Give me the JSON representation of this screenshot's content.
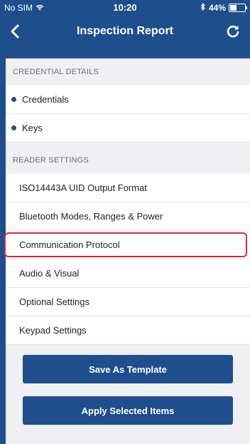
{
  "status_bar": {
    "carrier": "No SIM",
    "time": "10:20",
    "battery": "44%",
    "battery_level": 0.44
  },
  "nav": {
    "title": "Inspection Report",
    "back_icon": "chevron-left-icon",
    "refresh_icon": "refresh-icon"
  },
  "sections": {
    "credential_details": {
      "header": "CREDENTIAL DETAILS",
      "items": [
        "Credentials",
        "Keys"
      ]
    },
    "reader_settings": {
      "header": "READER SETTINGS",
      "items": [
        "ISO14443A UID Output Format",
        "Bluetooth Modes, Ranges & Power",
        "Communication Protocol",
        "Audio & Visual",
        "Optional Settings",
        "Keypad Settings"
      ],
      "highlighted_item": "Communication Protocol"
    }
  },
  "actions": {
    "save_template": "Save As Template",
    "apply_selected": "Apply Selected Items"
  },
  "colors": {
    "brand": "#1e4f8c",
    "highlight": "#e0282e",
    "background": "#efeff4"
  }
}
